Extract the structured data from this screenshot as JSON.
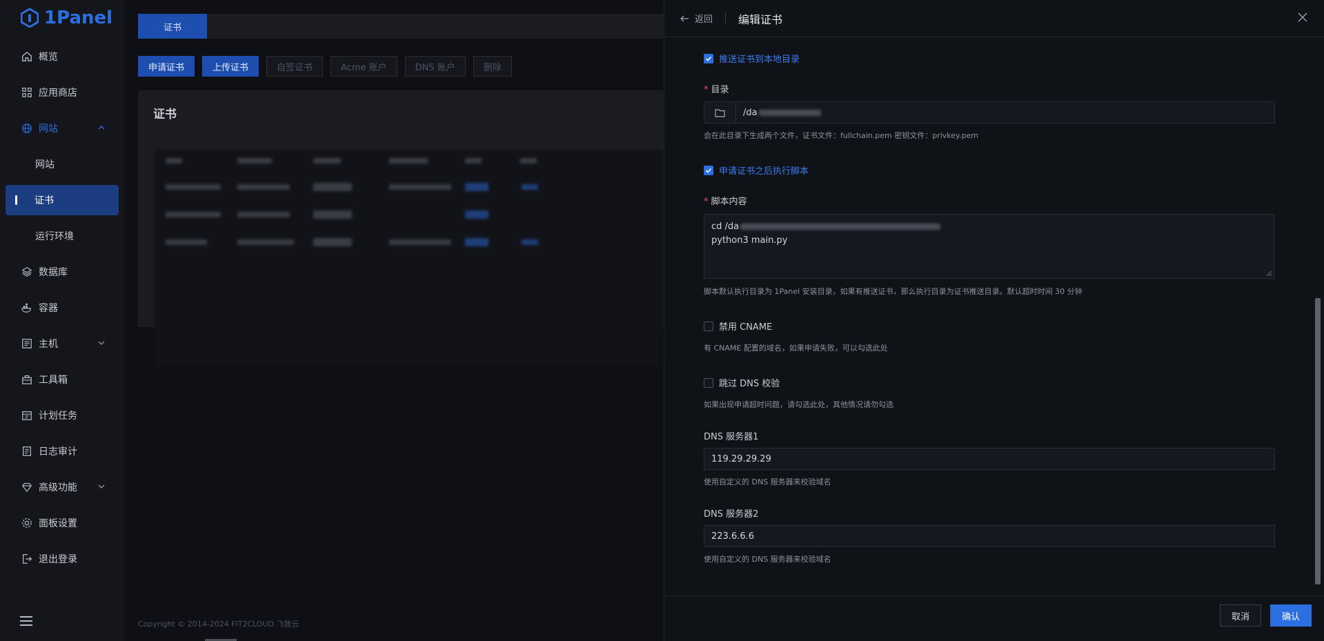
{
  "app": {
    "logo": "1Panel"
  },
  "sidebar": {
    "items": [
      {
        "label": "概览",
        "icon": "home-icon"
      },
      {
        "label": "应用商店",
        "icon": "apps-icon"
      },
      {
        "label": "网站",
        "icon": "globe-icon",
        "expanded": true
      },
      {
        "label": "网站",
        "icon": ""
      },
      {
        "label": "证书",
        "icon": "",
        "active": true
      },
      {
        "label": "运行环境",
        "icon": ""
      },
      {
        "label": "数据库",
        "icon": "database-icon"
      },
      {
        "label": "容器",
        "icon": "docker-icon"
      },
      {
        "label": "主机",
        "icon": "host-icon"
      },
      {
        "label": "工具箱",
        "icon": "toolbox-icon"
      },
      {
        "label": "计划任务",
        "icon": "calendar-icon"
      },
      {
        "label": "日志审计",
        "icon": "log-icon"
      },
      {
        "label": "高级功能",
        "icon": "diamond-icon"
      },
      {
        "label": "面板设置",
        "icon": "gear-icon"
      },
      {
        "label": "退出登录",
        "icon": "logout-icon"
      }
    ]
  },
  "main": {
    "tab": "证书",
    "buttons": [
      "申请证书",
      "上传证书",
      "自签证书",
      "Acme 账户",
      "DNS 账户",
      "删除"
    ],
    "card_title": "证书",
    "copyright": "Copyright © 2014-2024 FIT2CLOUD 飞致云"
  },
  "drawer": {
    "back_label": "返回",
    "title": "编辑证书",
    "push_to_local": {
      "label": "推送证书到本地目录",
      "checked": true
    },
    "dir": {
      "label": "目录",
      "value_prefix": "/da",
      "hint": "会在此目录下生成两个文件，证书文件：fullchain.pem 密钥文件：privkey.pem"
    },
    "exec_script": {
      "label": "申请证书之后执行脚本",
      "checked": true
    },
    "script": {
      "label": "脚本内容",
      "line1_prefix": "cd /da",
      "line2": "python3 main.py",
      "hint": "脚本默认执行目录为 1Panel 安装目录，如果有推送证书，那么执行目录为证书推送目录。默认超时时间 30 分钟"
    },
    "disable_cname": {
      "label": "禁用 CNAME",
      "checked": false,
      "hint": "有 CNAME 配置的域名，如果申请失败，可以勾选此处"
    },
    "skip_dns": {
      "label": "跳过 DNS 校验",
      "checked": false,
      "hint": "如果出现申请超时问题，请勾选此处，其他情况请勿勾选"
    },
    "dns1": {
      "label": "DNS 服务器1",
      "value": "119.29.29.29",
      "hint": "使用自定义的 DNS 服务器来校验域名"
    },
    "dns2": {
      "label": "DNS 服务器2",
      "value": "223.6.6.6",
      "hint": "使用自定义的 DNS 服务器来校验域名"
    },
    "cancel_label": "取消",
    "confirm_label": "确认"
  },
  "colors": {
    "accent": "#2b6fe0",
    "active_nav": "#1d3d82"
  }
}
